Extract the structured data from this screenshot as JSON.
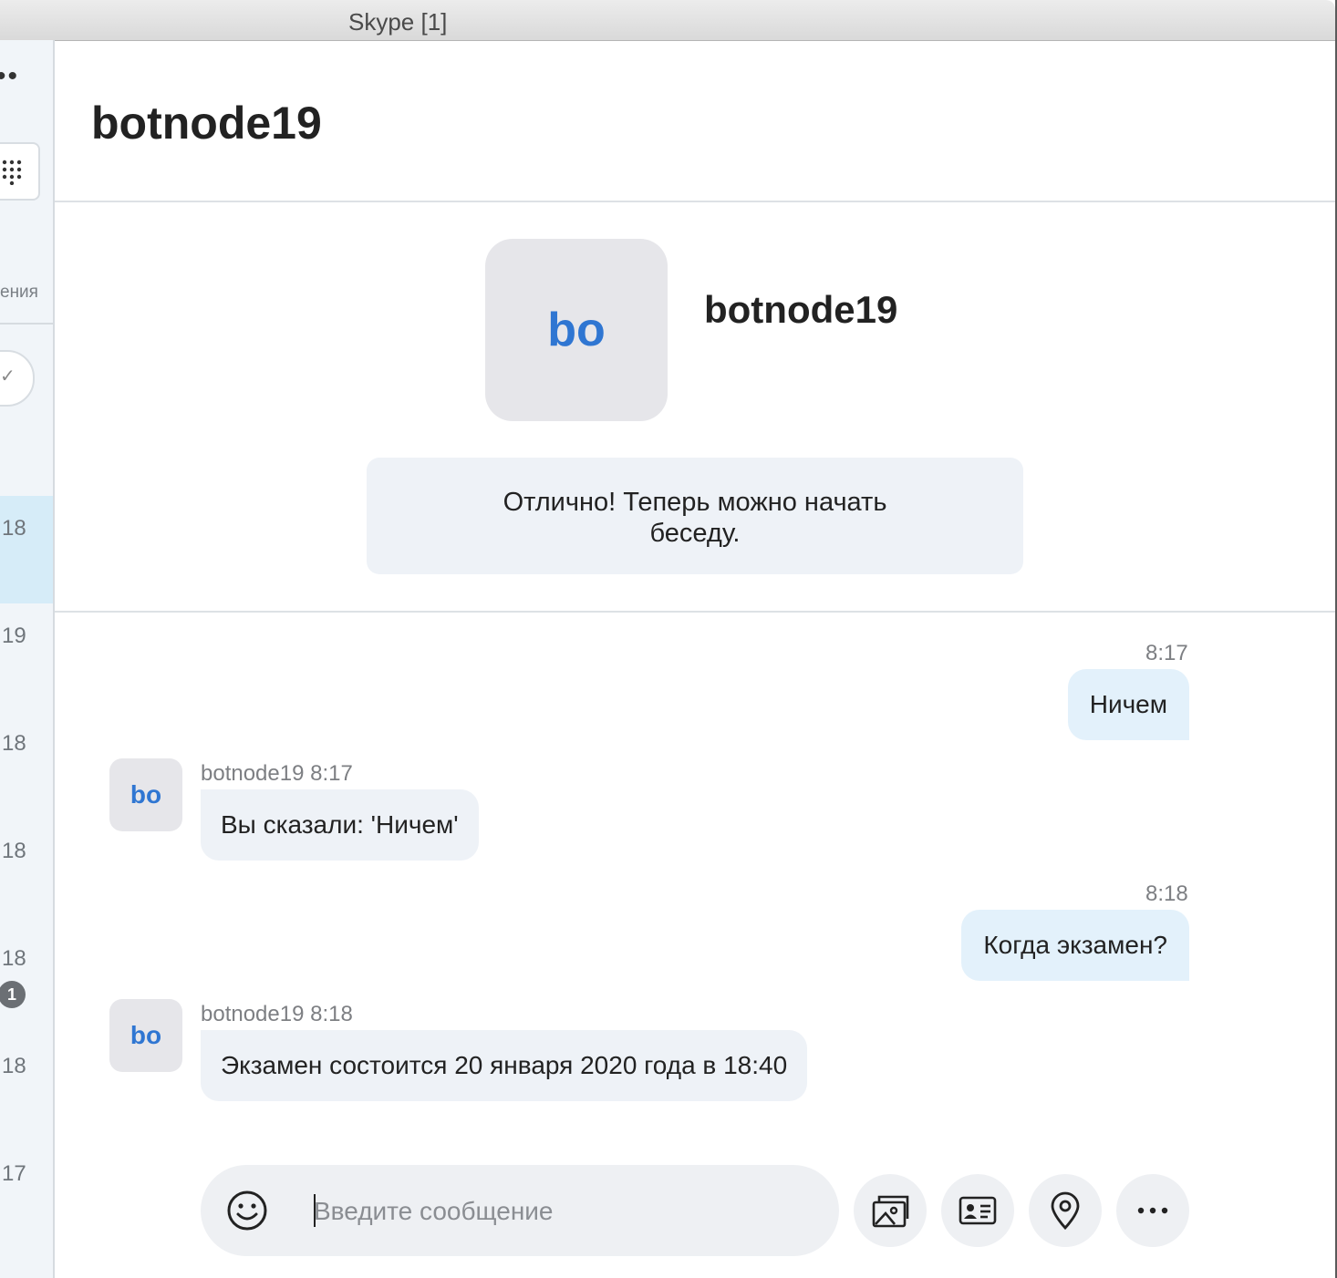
{
  "window": {
    "title": "Skype [1]"
  },
  "sidebar": {
    "tab_fragment": "ения",
    "rows": [
      {
        "time": "18",
        "active": true
      },
      {
        "time": "19"
      },
      {
        "time": "18"
      },
      {
        "time": "18"
      },
      {
        "time": "18"
      },
      {
        "time": "18"
      },
      {
        "time": "17"
      }
    ],
    "unread_badge": "1"
  },
  "chat": {
    "title": "botnode19",
    "intro": {
      "avatar_initials": "bo",
      "name": "botnode19",
      "message": "Отлично! Теперь можно начать беседу."
    },
    "messages": [
      {
        "direction": "out",
        "time": "8:17",
        "text": "Ничем"
      },
      {
        "direction": "in",
        "sender_time": "botnode19 8:17",
        "avatar": "bo",
        "text": "Вы сказали: 'Ничем'"
      },
      {
        "direction": "out",
        "time": "8:18",
        "text": "Когда экзамен?"
      },
      {
        "direction": "in",
        "sender_time": "botnode19 8:18",
        "avatar": "bo",
        "text": "Экзамен состоится 20 января 2020 года в 18:40"
      }
    ]
  },
  "composer": {
    "placeholder": "Введите сообщение",
    "value": "",
    "icons": [
      "emoji-icon",
      "media-icon",
      "contact-card-icon",
      "location-icon",
      "more-icon"
    ]
  }
}
